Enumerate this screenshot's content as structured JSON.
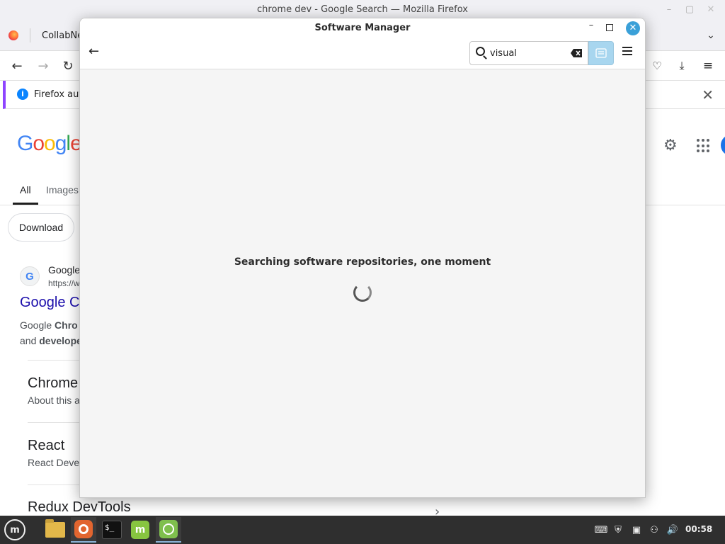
{
  "firefox": {
    "window_title": "chrome dev - Google Search — Mozilla Firefox",
    "tab_title": "CollabNet",
    "notification_text": "Firefox auto"
  },
  "google": {
    "logo_parts": [
      "G",
      "o",
      "o",
      "g",
      "l",
      "e"
    ],
    "tab_all": "All",
    "tab_images": "Images",
    "chip_download": "Download",
    "favicon_letter": "G",
    "result_site": "Google",
    "result_url": "https://w",
    "result_title": "Google C",
    "snippet_line1_a": "Google ",
    "snippet_line1_b": "Chro",
    "snippet_line2_a": "and ",
    "snippet_line2_b": "develope",
    "subresults": [
      {
        "title": "Chrome",
        "desc": "About this a"
      },
      {
        "title": "React",
        "desc": "React Deve"
      },
      {
        "title": "Redux DevTools",
        "desc": ""
      }
    ]
  },
  "software_manager": {
    "title": "Software Manager",
    "search_value": "visual",
    "status_text": "Searching software repositories, one moment"
  },
  "taskbar": {
    "clock": "00:58"
  },
  "colors": {
    "accent": "#3aa0d8",
    "filter_active": "#a8d6ef",
    "taskbar": "#2f2f2f",
    "google_link": "#1a0dab"
  }
}
